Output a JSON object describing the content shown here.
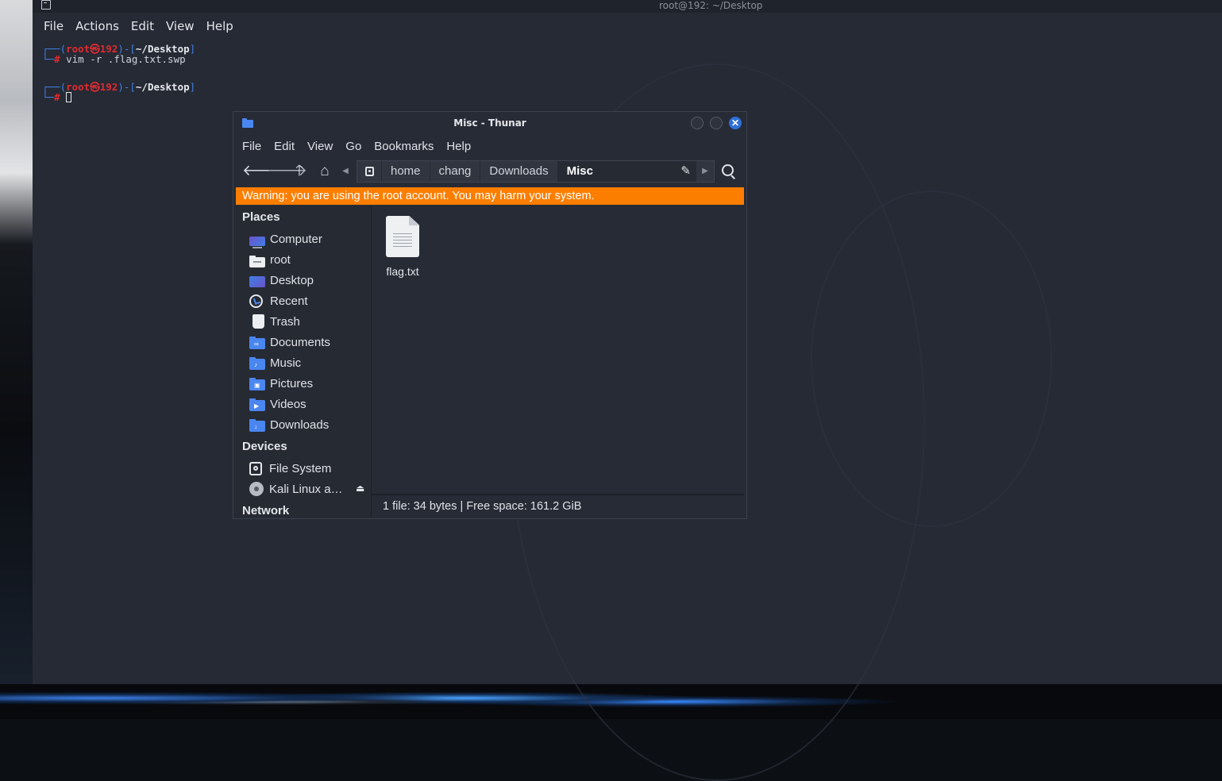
{
  "terminal": {
    "title": "root@192: ~/Desktop",
    "menu": [
      "File",
      "Actions",
      "Edit",
      "View",
      "Help"
    ],
    "prompt1": {
      "user": "root",
      "host": "192",
      "path": "~/Desktop",
      "command": "vim -r .flag.txt.swp"
    },
    "prompt2": {
      "user": "root",
      "host": "192",
      "path": "~/Desktop",
      "command": ""
    }
  },
  "thunar": {
    "title": "Misc - Thunar",
    "menu": [
      "File",
      "Edit",
      "View",
      "Go",
      "Bookmarks",
      "Help"
    ],
    "path_segments": [
      "home",
      "chang",
      "Downloads",
      "Misc"
    ],
    "warning": "Warning: you are using the root account. You may harm your system.",
    "sidebar": {
      "places_heading": "Places",
      "places": [
        "Computer",
        "root",
        "Desktop",
        "Recent",
        "Trash",
        "Documents",
        "Music",
        "Pictures",
        "Videos",
        "Downloads"
      ],
      "devices_heading": "Devices",
      "devices": [
        "File System",
        "Kali Linux a…"
      ],
      "network_heading": "Network"
    },
    "files": [
      {
        "name": "flag.txt",
        "icon": "text-file-icon"
      }
    ],
    "status": "1 file: 34 bytes  |  Free space: 161.2 GiB"
  }
}
